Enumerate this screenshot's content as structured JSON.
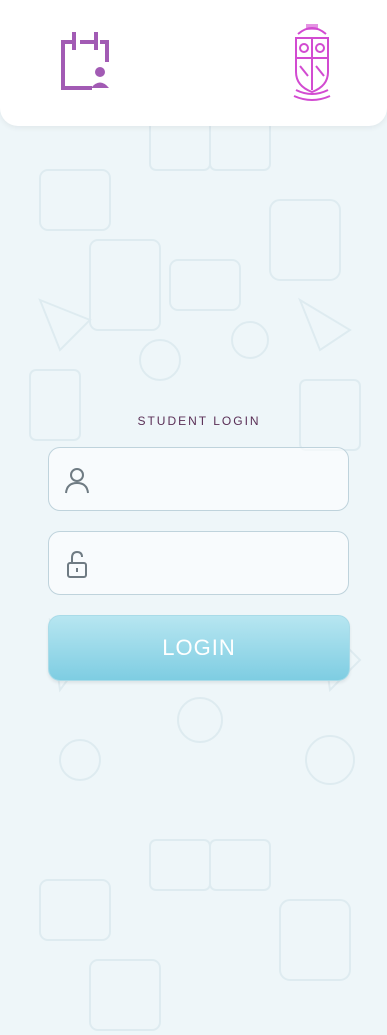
{
  "header": {
    "left_icon": "calendar-person-icon",
    "right_icon": "school-crest-logo"
  },
  "login": {
    "title": "STUDENT LOGIN",
    "username_icon": "user-icon",
    "password_icon": "lock-icon",
    "button_label": "LOGIN"
  },
  "colors": {
    "brand_purple": "#9b58b5",
    "crest_magenta": "#d24bd1",
    "button_blue": "#7ecde2",
    "title_color": "#5a2f56"
  }
}
